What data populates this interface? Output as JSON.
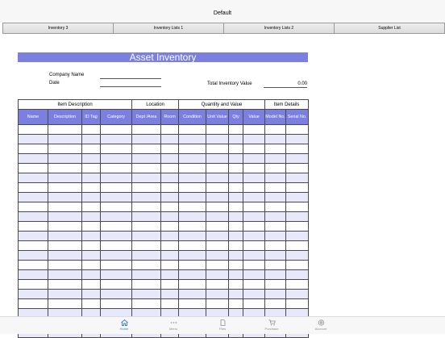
{
  "window": {
    "title": "Default"
  },
  "sheet_tabs": [
    "Inventory 3",
    "Inventory Lists 1",
    "Inventory Lists 2",
    "Supplier List"
  ],
  "sheet": {
    "title": "Asset Inventory",
    "company_label": "Company Name",
    "date_label": "Date",
    "total_label": "Total Inventory Value",
    "total_value": "0.00"
  },
  "table": {
    "groups": [
      "Item Description",
      "Location",
      "Quantity and Value",
      "Item Details"
    ],
    "columns": [
      "Name",
      "Description",
      "ID Tag",
      "Category",
      "Dept /Area",
      "Room",
      "Condition",
      "Unit Value",
      "Qty",
      "Value",
      "Model No.",
      "Serial No."
    ]
  },
  "tabbar": [
    {
      "label": "Home",
      "icon": "home-icon",
      "active": true
    },
    {
      "label": "Menu",
      "icon": "more-icon"
    },
    {
      "label": "Files",
      "icon": "file-icon"
    },
    {
      "label": "Purchase",
      "icon": "cart-icon"
    },
    {
      "label": "Account",
      "icon": "gear-icon"
    }
  ],
  "colors": {
    "accent": "#7b7fe0",
    "row_alt": "#e7e9fb",
    "tab_active": "#3478f6"
  }
}
